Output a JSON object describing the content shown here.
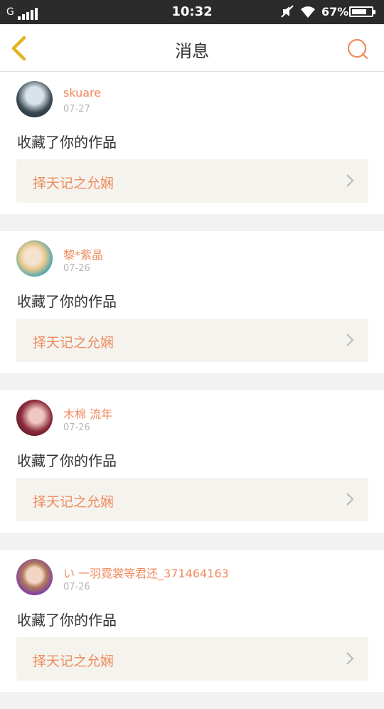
{
  "status_bar": {
    "carrier": "G",
    "time": "10:32",
    "battery": "67%"
  },
  "header": {
    "title": "消息",
    "back_icon": "chevron-left-icon",
    "search_icon": "search-icon",
    "accent": "#f08a5d",
    "back_color": "#e3b41e"
  },
  "messages": [
    {
      "username": "skuare",
      "date": "07-27",
      "action": "收藏了你的作品",
      "work": "择天记之允娴"
    },
    {
      "username": "黎*紫晶",
      "date": "07-26",
      "action": "收藏了你的作品",
      "work": "择天记之允娴"
    },
    {
      "username": "木棉 流年",
      "date": "07-26",
      "action": "收藏了你的作品",
      "work": "择天记之允娴"
    },
    {
      "username": "い 一羽霓裳等君还_371464163",
      "date": "07-26",
      "action": "收藏了你的作品",
      "work": "择天记之允娴"
    }
  ]
}
